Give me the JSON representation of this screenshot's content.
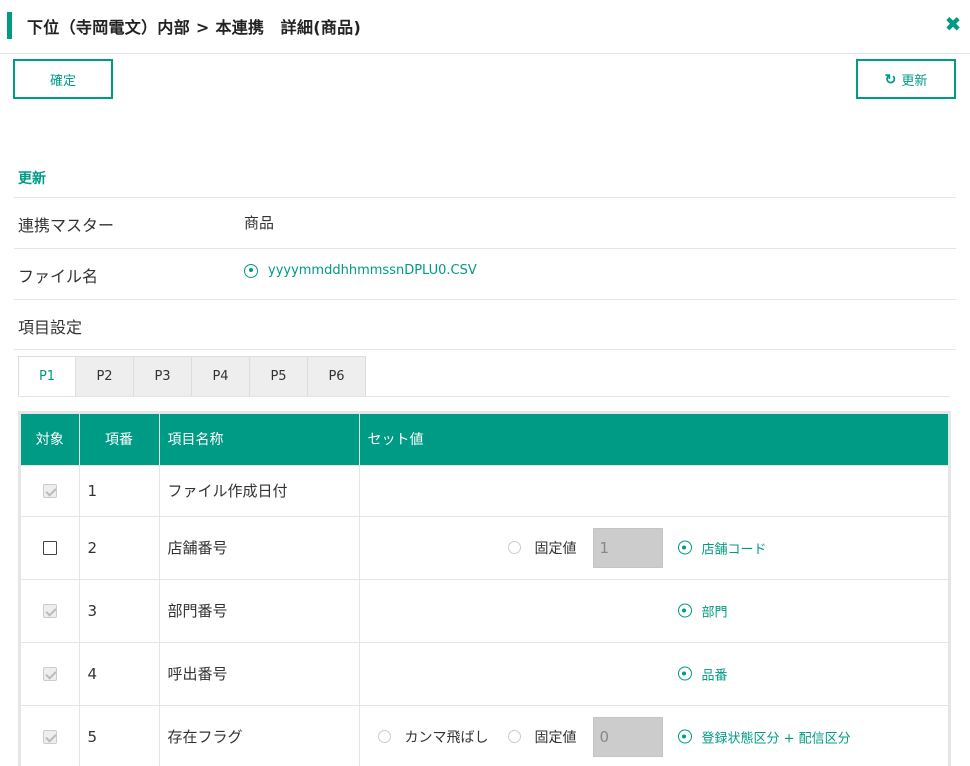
{
  "header": {
    "title": "下位（寺岡電文）内部 > 本連携　詳細(商品)",
    "close_glyph": "✖"
  },
  "toolbar": {
    "confirm_label": "確定",
    "refresh_label": "更新",
    "refresh_glyph": "↻"
  },
  "section": {
    "title": "更新"
  },
  "info": {
    "master_label": "連携マスター",
    "master_value": "商品",
    "file_label": "ファイル名",
    "file_value": "yyyymmddhhmmssnDPLU0.CSV",
    "items_label": "項目設定"
  },
  "tabs": [
    "P1",
    "P2",
    "P3",
    "P4",
    "P5",
    "P6"
  ],
  "active_tab": "P1",
  "table": {
    "headers": {
      "target": "対象",
      "num": "項番",
      "name": "項目名称",
      "set": "セット値"
    },
    "rows": [
      {
        "num": "1",
        "name": "ファイル作成日付",
        "checked": true,
        "disabled": true
      },
      {
        "num": "2",
        "name": "店舗番号",
        "checked": false,
        "disabled": false,
        "fixed_label": "固定値",
        "fixed_value": "1",
        "map_label": "店舗コード"
      },
      {
        "num": "3",
        "name": "部門番号",
        "checked": true,
        "disabled": true,
        "map_label": "部門"
      },
      {
        "num": "4",
        "name": "呼出番号",
        "checked": true,
        "disabled": true,
        "map_label": "品番"
      },
      {
        "num": "5",
        "name": "存在フラグ",
        "checked": true,
        "disabled": true,
        "skip_label": "カンマ飛ばし",
        "fixed_label": "固定値",
        "fixed_value": "0",
        "map_label": "登録状態区分 + 配信区分"
      }
    ]
  },
  "colors": {
    "accent": "#009b85",
    "header_bg": "#009b85",
    "tab_inactive": "#eeeeee",
    "input_disabled": "#cccccc"
  }
}
